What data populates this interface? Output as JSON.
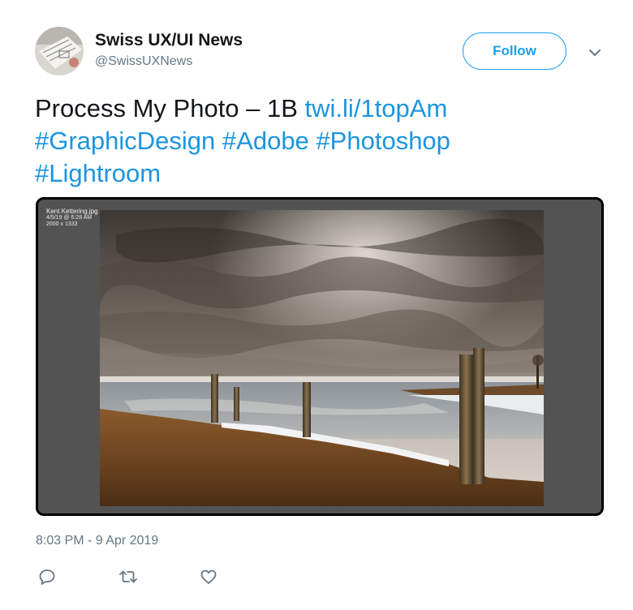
{
  "author": {
    "name": "Swiss UX/UI News",
    "handle": "@SwissUXNews"
  },
  "header": {
    "follow_label": "Follow",
    "more_icon": "chevron-down-icon"
  },
  "tweet": {
    "text_plain": "Process My Photo – 1B ",
    "link": "twi.li/1topAm",
    "hashtags": [
      "#GraphicDesign",
      "#Adobe",
      "#Photoshop",
      "#Lightroom"
    ]
  },
  "media": {
    "filename": "Kent Kettering.jpg",
    "meta_line1": "4/5/19 @ 6:28 AM",
    "meta_line2": "2000 x 1333"
  },
  "timestamp": "8:03 PM - 9 Apr 2019",
  "actions": {
    "reply_icon": "reply-icon",
    "retweet_icon": "retweet-icon",
    "like_icon": "heart-icon"
  },
  "colors": {
    "link": "#1b95e0",
    "follow_border": "#1da1f2",
    "secondary_text": "#657786"
  }
}
